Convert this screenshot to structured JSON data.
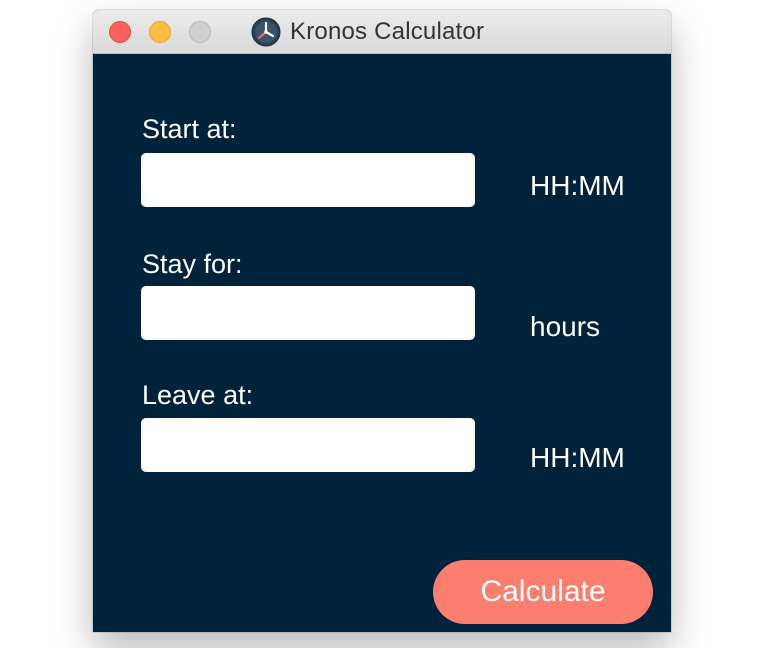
{
  "window": {
    "title": "Kronos Calculator"
  },
  "form": {
    "fields": [
      {
        "label": "Start at:",
        "value": "",
        "placeholder": "",
        "unit": "HH:MM"
      },
      {
        "label": "Stay for:",
        "value": "",
        "placeholder": "",
        "unit": "hours"
      },
      {
        "label": "Leave at:",
        "value": "",
        "placeholder": "",
        "unit": "HH:MM"
      }
    ],
    "calculate_label": "Calculate"
  },
  "icons": {
    "app": "clock-icon",
    "close": "close-traffic-light",
    "minimize": "minimize-traffic-light",
    "zoom": "zoom-traffic-light"
  },
  "colors": {
    "background": "#00223a",
    "button": "#fb7e6f",
    "text": "#ffffff",
    "close": "#fc605c",
    "minimize": "#fdbc40",
    "zoom_disabled": "#cfcfcf"
  }
}
